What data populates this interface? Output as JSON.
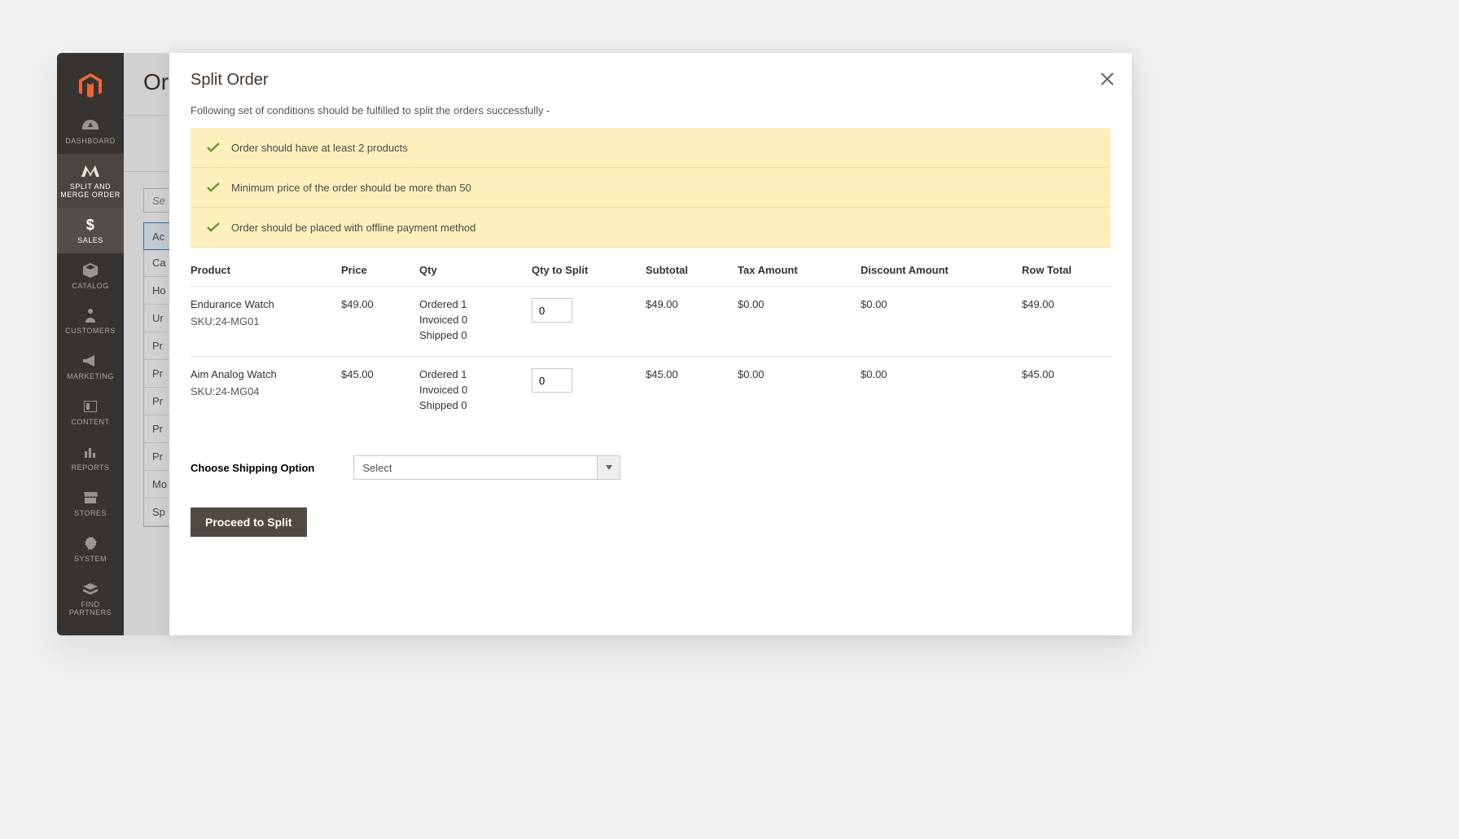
{
  "sidebar": {
    "items": [
      {
        "label": "DASHBOARD"
      },
      {
        "label": "SPLIT AND MERGE ORDER"
      },
      {
        "label": "SALES"
      },
      {
        "label": "CATALOG"
      },
      {
        "label": "CUSTOMERS"
      },
      {
        "label": "MARKETING"
      },
      {
        "label": "CONTENT"
      },
      {
        "label": "REPORTS"
      },
      {
        "label": "STORES"
      },
      {
        "label": "SYSTEM"
      },
      {
        "label": "FIND PARTNERS"
      }
    ]
  },
  "backdrop": {
    "title": "Or",
    "search_placeholder": "Se",
    "rows": [
      "Ac",
      "Ca",
      "Ho",
      "Ur",
      "Pr",
      "Pr",
      "Pr",
      "Pr",
      "Pr",
      "Mo",
      "Sp"
    ]
  },
  "modal": {
    "title": "Split Order",
    "subtitle": "Following set of conditions should be fulfilled to split the orders successfully -",
    "conditions": [
      "Order should have at least 2 products",
      "Minimum price of the order should be more than 50",
      "Order should be placed with offline payment method"
    ],
    "columns": {
      "product": "Product",
      "price": "Price",
      "qty": "Qty",
      "qty_split": "Qty to Split",
      "subtotal": "Subtotal",
      "tax": "Tax Amount",
      "discount": "Discount Amount",
      "row_total": "Row Total"
    },
    "rows": [
      {
        "name": "Endurance Watch",
        "sku": "SKU:24-MG01",
        "price": "$49.00",
        "ordered": "Ordered  1",
        "invoiced": "Invoiced  0",
        "shipped": "Shipped  0",
        "qty_split": "0",
        "subtotal": "$49.00",
        "tax": "$0.00",
        "discount": "$0.00",
        "row_total": "$49.00"
      },
      {
        "name": "Aim Analog Watch",
        "sku": "SKU:24-MG04",
        "price": "$45.00",
        "ordered": "Ordered  1",
        "invoiced": "Invoiced  0",
        "shipped": "Shipped  0",
        "qty_split": "0",
        "subtotal": "$45.00",
        "tax": "$0.00",
        "discount": "$0.00",
        "row_total": "$45.00"
      }
    ],
    "shipping_label": "Choose Shipping Option",
    "shipping_value": "Select",
    "proceed": "Proceed to Split"
  }
}
